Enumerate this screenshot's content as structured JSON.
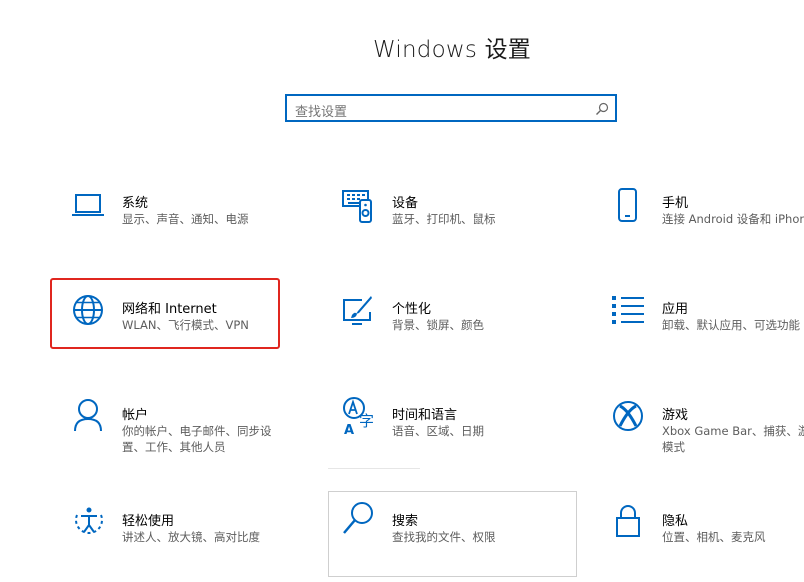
{
  "window": {
    "title": "Windows 设置"
  },
  "search": {
    "placeholder": "查找设置"
  },
  "tiles": [
    {
      "name": "系统",
      "desc": [
        "显示、声音、通知、电源"
      ],
      "icon": "laptop-icon"
    },
    {
      "name": "设备",
      "desc": [
        "蓝牙、打印机、鼠标"
      ],
      "icon": "devices-icon"
    },
    {
      "name": "手机",
      "desc": [
        "连接 Android 设备和 iPhone"
      ],
      "icon": "phone-icon"
    },
    {
      "name": "网络和 Internet",
      "desc": [
        "WLAN、飞行模式、VPN"
      ],
      "icon": "globe-icon",
      "highlighted": true
    },
    {
      "name": "个性化",
      "desc": [
        "背景、锁屏、颜色"
      ],
      "icon": "personalization-icon"
    },
    {
      "name": "应用",
      "desc": [
        "卸载、默认应用、可选功能"
      ],
      "icon": "apps-icon"
    },
    {
      "name": "帐户",
      "desc": [
        "你的帐户、电子邮件、同步设",
        "置、工作、其他人员"
      ],
      "icon": "person-icon"
    },
    {
      "name": "时间和语言",
      "desc": [
        "语音、区域、日期"
      ],
      "icon": "time-language-icon"
    },
    {
      "name": "游戏",
      "desc": [
        "Xbox Game Bar、捕获、游戏",
        "模式"
      ],
      "icon": "xbox-icon"
    },
    {
      "name": "轻松使用",
      "desc": [
        "讲述人、放大镜、高对比度"
      ],
      "icon": "ease-of-access-icon"
    },
    {
      "name": "搜索",
      "desc": [
        "查找我的文件、权限"
      ],
      "icon": "search-icon",
      "hovered": true
    },
    {
      "name": "隐私",
      "desc": [
        "位置、相机、麦克风"
      ],
      "icon": "lock-icon"
    }
  ],
  "colors": {
    "accent": "#0067c0",
    "highlight": "#e0261f"
  }
}
